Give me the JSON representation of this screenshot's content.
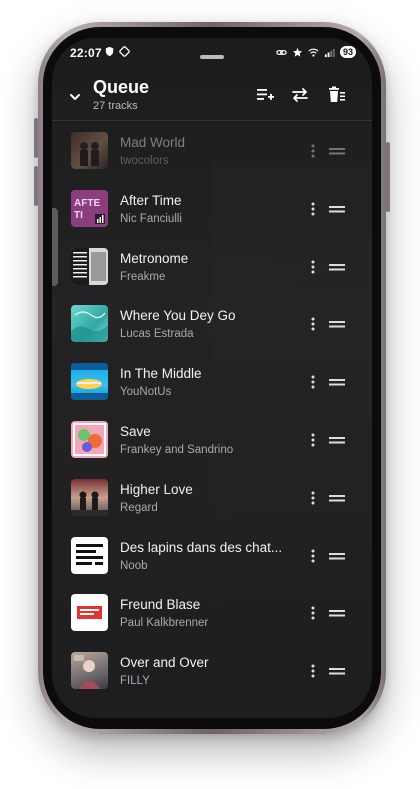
{
  "status_bar": {
    "time": "22:07",
    "battery": "93",
    "icons_left": [
      "shield-icon",
      "nfc-icon"
    ],
    "icons_right": [
      "link-icon",
      "star-icon",
      "wifi-icon",
      "signal-icon",
      "battery-icon"
    ]
  },
  "header": {
    "title": "Queue",
    "subtitle": "27 tracks",
    "collapse_icon": "chevron-down-icon",
    "actions": [
      "add-to-playlist-icon",
      "repeat-icon",
      "clear-queue-icon"
    ]
  },
  "colors": {
    "background": "#1c1c1e",
    "text_primary": "#f2f2f4",
    "text_secondary": "#a9a9ae"
  },
  "tracks": [
    {
      "title": "Mad World",
      "artist": "twocolors",
      "dim": true
    },
    {
      "title": "After Time",
      "artist": "Nic Fanciulli"
    },
    {
      "title": "Metronome",
      "artist": "Freakme"
    },
    {
      "title": "Where You Dey Go",
      "artist": "Lucas Estrada"
    },
    {
      "title": "In The Middle",
      "artist": "YouNotUs"
    },
    {
      "title": "Save",
      "artist": "Frankey and Sandrino"
    },
    {
      "title": "Higher Love",
      "artist": "Regard"
    },
    {
      "title": "Des lapins dans des chat...",
      "artist": "Noob"
    },
    {
      "title": "Freund Blase",
      "artist": "Paul Kalkbrenner"
    },
    {
      "title": "Over and Over",
      "artist": "FILLY"
    }
  ]
}
